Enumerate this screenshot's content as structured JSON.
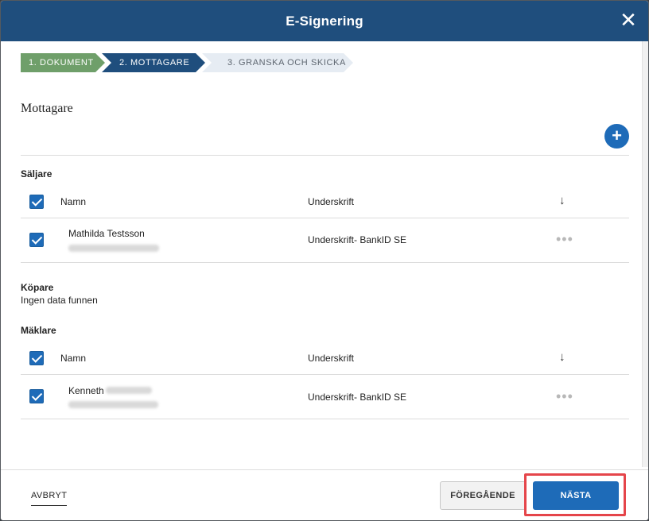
{
  "modal": {
    "title": "E-Signering",
    "close_glyph": "✕"
  },
  "stepper": [
    {
      "label": "1. DOKUMENT",
      "state": "completed"
    },
    {
      "label": "2. MOTTAGARE",
      "state": "active"
    },
    {
      "label": "3. GRANSKA OCH SKICKA",
      "state": "pending"
    }
  ],
  "section": {
    "title": "Mottagare",
    "add_glyph": "+"
  },
  "groups": {
    "seller": {
      "label": "Säljare",
      "header": {
        "name": "Namn",
        "signature": "Underskrift",
        "sort_glyph": "↓"
      },
      "rows": [
        {
          "name": "Mathilda Testsson",
          "signature": "Underskrift- BankID SE"
        }
      ]
    },
    "buyer": {
      "label": "Köpare",
      "empty": "Ingen data funnen"
    },
    "broker": {
      "label": "Mäklare",
      "header": {
        "name": "Namn",
        "signature": "Underskrift",
        "sort_glyph": "↓"
      },
      "rows": [
        {
          "name": "Kenneth",
          "signature": "Underskrift- BankID SE"
        }
      ]
    }
  },
  "row_menu_glyph": "•••",
  "footer": {
    "cancel": "AVBRYT",
    "previous": "FÖREGÅENDE",
    "next": "NÄSTA"
  },
  "colors": {
    "header": "#1f4e7d",
    "step_completed": "#6f9f6a",
    "step_active": "#1f4e7d",
    "step_pending": "#e6ecf3",
    "primary": "#1e6bb8",
    "highlight": "#e5454a"
  },
  "icons": [
    "close-icon",
    "plus-icon",
    "sort-down-icon",
    "checkbox-checked-icon",
    "more-dots-icon"
  ]
}
